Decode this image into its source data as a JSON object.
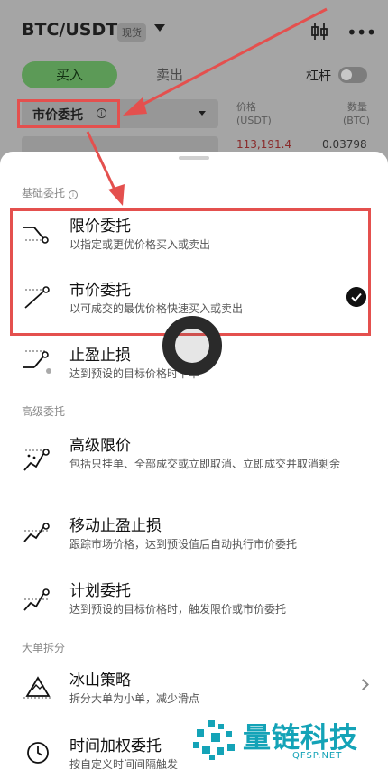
{
  "header": {
    "pair": "BTC/USDT",
    "market_tag": "现货",
    "icons": [
      "candlestick-chart-icon",
      "more-dots-icon"
    ]
  },
  "trade": {
    "buy_label": "买入",
    "sell_label": "卖出",
    "leverage_label": "杠杆",
    "leverage_enabled": false,
    "order_type_selected": "市价委托",
    "price_header": "价格",
    "price_unit": "(USDT)",
    "qty_header": "数量",
    "qty_unit": "(BTC)",
    "price_value": "113,191.4",
    "qty_value": "0.03798"
  },
  "sheet": {
    "sections": [
      {
        "title": "基础委托",
        "items": [
          {
            "title": "限价委托",
            "desc": "以指定或更优价格买入或卖出",
            "icon": "limit-order-icon",
            "selected": false
          },
          {
            "title": "市价委托",
            "desc": "以可成交的最优价格快速买入或卖出",
            "icon": "market-order-icon",
            "selected": true
          },
          {
            "title": "止盈止损",
            "desc": "达到预设的目标价格时下单",
            "icon": "take-profit-stop-loss-icon",
            "selected": false
          }
        ]
      },
      {
        "title": "高级委托",
        "items": [
          {
            "title": "高级限价",
            "desc": "包括只挂单、全部成交或立即取消、立即成交并取消剩余",
            "icon": "advanced-limit-icon"
          },
          {
            "title": "移动止盈止损",
            "desc": "跟踪市场价格，达到预设值后自动执行市价委托",
            "icon": "trailing-stop-icon"
          },
          {
            "title": "计划委托",
            "desc": "达到预设的目标价格时，触发限价或市价委托",
            "icon": "trigger-order-icon"
          }
        ]
      },
      {
        "title": "大单拆分",
        "items": [
          {
            "title": "冰山策略",
            "desc": "拆分大单为小单，减少滑点",
            "icon": "iceberg-icon"
          },
          {
            "title": "时间加权委托",
            "desc": "按自定义时间间隔触发",
            "icon": "clock-icon"
          }
        ]
      }
    ]
  },
  "watermark": {
    "text": "量链科技",
    "url": "QFSP.NET"
  },
  "colors": {
    "highlight": "#e4504e",
    "buy": "#5c9a57",
    "brand_watermark": "#14a3b7"
  }
}
